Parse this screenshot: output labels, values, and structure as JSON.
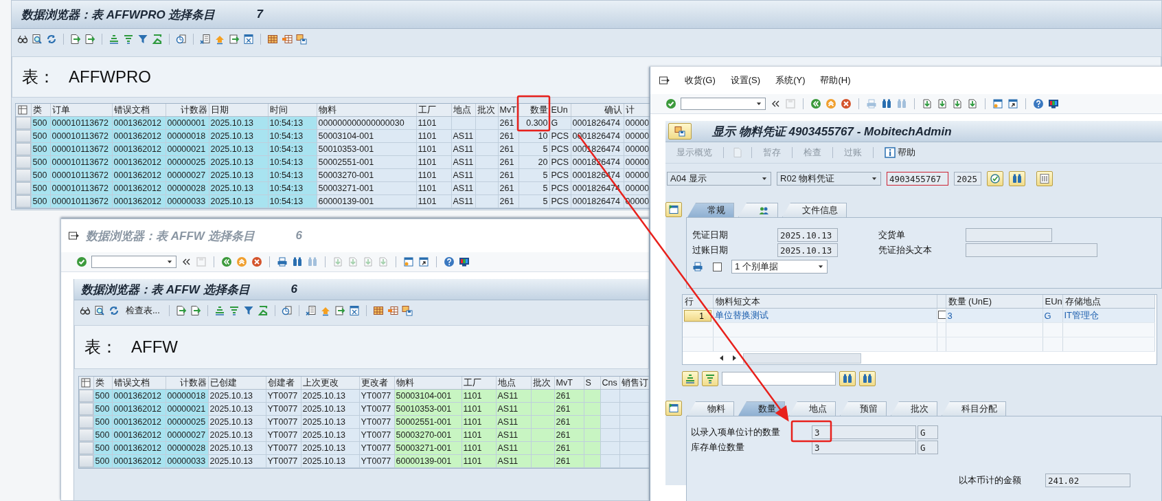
{
  "data_browser_affwpro": {
    "title": "数据浏览器：表 AFFWPRO 选择条目",
    "count": "7",
    "table_label": "表：",
    "table_name": "AFFWPRO",
    "table": {
      "columns": [
        {
          "label": "类",
          "kind": "key"
        },
        {
          "label": "订单",
          "kind": "key"
        },
        {
          "label": "错误文档",
          "kind": "key"
        },
        {
          "label": "计数器",
          "kind": "key"
        },
        {
          "label": "日期",
          "kind": "key"
        },
        {
          "label": "时间",
          "kind": "key"
        },
        {
          "label": "物料",
          "kind": "plain"
        },
        {
          "label": "工厂",
          "kind": "plain"
        },
        {
          "label": "地点",
          "kind": "plain"
        },
        {
          "label": "批次",
          "kind": "plain"
        },
        {
          "label": "MvT",
          "kind": "plain"
        },
        {
          "label": "数量",
          "kind": "plain"
        },
        {
          "label": "EUn",
          "kind": "plain"
        },
        {
          "label": "确认",
          "kind": "plain"
        },
        {
          "label": "计",
          "kind": "plain"
        }
      ],
      "rows": [
        [
          "500",
          "000010113672",
          "0001362012",
          "00000001",
          "2025.10.13",
          "10:54:13",
          "000000000000000030",
          "1101",
          null,
          null,
          "261",
          "0.300",
          "G",
          "0001826474",
          "00000"
        ],
        [
          "500",
          "000010113672",
          "0001362012",
          "00000018",
          "2025.10.13",
          "10:54:13",
          "50003104-001",
          "1101",
          "AS11",
          null,
          "261",
          "10",
          "PCS",
          "0001826474",
          "00000"
        ],
        [
          "500",
          "000010113672",
          "0001362012",
          "00000021",
          "2025.10.13",
          "10:54:13",
          "50010353-001",
          "1101",
          "AS11",
          null,
          "261",
          "5",
          "PCS",
          "0001826474",
          "00000"
        ],
        [
          "500",
          "000010113672",
          "0001362012",
          "00000025",
          "2025.10.13",
          "10:54:13",
          "50002551-001",
          "1101",
          "AS11",
          null,
          "261",
          "20",
          "PCS",
          "0001826474",
          "00000"
        ],
        [
          "500",
          "000010113672",
          "0001362012",
          "00000027",
          "2025.10.13",
          "10:54:13",
          "50003270-001",
          "1101",
          "AS11",
          null,
          "261",
          "5",
          "PCS",
          "0001826474",
          "00000"
        ],
        [
          "500",
          "000010113672",
          "0001362012",
          "00000028",
          "2025.10.13",
          "10:54:13",
          "50003271-001",
          "1101",
          "AS11",
          null,
          "261",
          "5",
          "PCS",
          "0001826474",
          "00000"
        ],
        [
          "500",
          "000010113672",
          "0001362012",
          "00000033",
          "2025.10.13",
          "10:54:13",
          "60000139-001",
          "1101",
          "AS11",
          null,
          "261",
          "5",
          "PCS",
          "0001826474",
          "00000"
        ]
      ]
    }
  },
  "data_browser_affw": {
    "title": "数据浏览器：表 AFFW 选择条目",
    "count": "6",
    "command_toolbar": {
      "page_nav_enabled": false
    },
    "inner_title": "数据浏览器：表 AFFW 选择条目",
    "inner_count": "6",
    "check_table_button": "检查表...",
    "table_label": "表：",
    "table_name": "AFFW",
    "table": {
      "columns": [
        {
          "label": "类",
          "kind": "key"
        },
        {
          "label": "错误文档",
          "kind": "key"
        },
        {
          "label": "计数器",
          "kind": "key"
        },
        {
          "label": "已创建",
          "kind": "plain"
        },
        {
          "label": "创建者",
          "kind": "plain"
        },
        {
          "label": "上次更改",
          "kind": "plain"
        },
        {
          "label": "更改者",
          "kind": "plain"
        },
        {
          "label": "物料",
          "kind": "green"
        },
        {
          "label": "工厂",
          "kind": "green"
        },
        {
          "label": "地点",
          "kind": "green"
        },
        {
          "label": "批次",
          "kind": "green"
        },
        {
          "label": "MvT",
          "kind": "green"
        },
        {
          "label": "S",
          "kind": "green"
        },
        {
          "label": "Cns",
          "kind": "plain"
        },
        {
          "label": "销售订",
          "kind": "plain"
        }
      ],
      "rows": [
        [
          "500",
          "0001362012",
          "00000018",
          "2025.10.13",
          "YT0077",
          "2025.10.13",
          "YT0077",
          "50003104-001",
          "1101",
          "AS11",
          null,
          "261",
          null,
          null,
          null
        ],
        [
          "500",
          "0001362012",
          "00000021",
          "2025.10.13",
          "YT0077",
          "2025.10.13",
          "YT0077",
          "50010353-001",
          "1101",
          "AS11",
          null,
          "261",
          null,
          null,
          null
        ],
        [
          "500",
          "0001362012",
          "00000025",
          "2025.10.13",
          "YT0077",
          "2025.10.13",
          "YT0077",
          "50002551-001",
          "1101",
          "AS11",
          null,
          "261",
          null,
          null,
          null
        ],
        [
          "500",
          "0001362012",
          "00000027",
          "2025.10.13",
          "YT0077",
          "2025.10.13",
          "YT0077",
          "50003270-001",
          "1101",
          "AS11",
          null,
          "261",
          null,
          null,
          null
        ],
        [
          "500",
          "0001362012",
          "00000028",
          "2025.10.13",
          "YT0077",
          "2025.10.13",
          "YT0077",
          "50003271-001",
          "1101",
          "AS11",
          null,
          "261",
          null,
          null,
          null
        ],
        [
          "500",
          "0001362012",
          "00000033",
          "2025.10.13",
          "YT0077",
          "2025.10.13",
          "YT0077",
          "60000139-001",
          "1101",
          "AS11",
          null,
          "261",
          null,
          null,
          null
        ]
      ]
    }
  },
  "material_document": {
    "menu": [
      "收货(G)",
      "设置(S)",
      "系统(Y)",
      "帮助(H)"
    ],
    "command_toolbar": {
      "page_nav_enabled": true
    },
    "title": "显示 物料凭证 4903455767 - MobitechAdmin",
    "app_toolbar": [
      {
        "kind": "text",
        "label": "显示概览",
        "disabled": true
      },
      {
        "kind": "icon",
        "disabled": true
      },
      {
        "kind": "text",
        "label": "暂存",
        "disabled": true
      },
      {
        "kind": "text",
        "label": "检查",
        "disabled": true
      },
      {
        "kind": "text",
        "label": "过账",
        "disabled": true
      },
      {
        "kind": "info",
        "label": "帮助",
        "disabled": false
      }
    ],
    "action": "A04 显示",
    "reference": "R02 物料凭证",
    "document_number": "4903455767",
    "year": "2025",
    "header_tabs": [
      {
        "kind": "text",
        "label": "常规",
        "selected": true
      },
      {
        "kind": "icon",
        "selected": false
      },
      {
        "kind": "text",
        "label": "文件信息",
        "selected": false
      }
    ],
    "header_fields": {
      "document_date_label": "凭证日期",
      "document_date": "2025.10.13",
      "posting_date_label": "过账日期",
      "posting_date": "2025.10.13",
      "delivery_note_label": "交货单",
      "header_text_label": "凭证抬头文本",
      "print_checked": false,
      "print_version": "1 个别单据"
    },
    "items": {
      "columns": [
        {
          "kind": "text",
          "label": "行"
        },
        {
          "kind": "text",
          "label": "物料短文本"
        },
        {
          "kind": "check"
        },
        {
          "kind": "text",
          "label": "数量 (UnE)"
        },
        {
          "kind": "text",
          "label": "EUn"
        },
        {
          "kind": "text",
          "label": "存储地点"
        }
      ],
      "rows": [
        {
          "line": "1",
          "text": "单位替换测试",
          "ok": false,
          "quantity": "3",
          "unit": "G",
          "storage_location": "IT管理仓"
        }
      ]
    },
    "detail_tabs": [
      {
        "label": "物料",
        "selected": false
      },
      {
        "label": "数量",
        "selected": true
      },
      {
        "label": "地点",
        "selected": false
      },
      {
        "label": "预留",
        "selected": false
      },
      {
        "label": "批次",
        "selected": false
      },
      {
        "label": "科目分配",
        "selected": false
      }
    ],
    "detail_fields": {
      "entry_quantity_label": "以录入项单位计的数量",
      "entry_quantity": "3",
      "entry_unit": "G",
      "stock_quantity_label": "库存单位数量",
      "stock_quantity": "3",
      "stock_unit": "G",
      "amount_label": "以本币计的金额",
      "amount": "241.02"
    }
  }
}
